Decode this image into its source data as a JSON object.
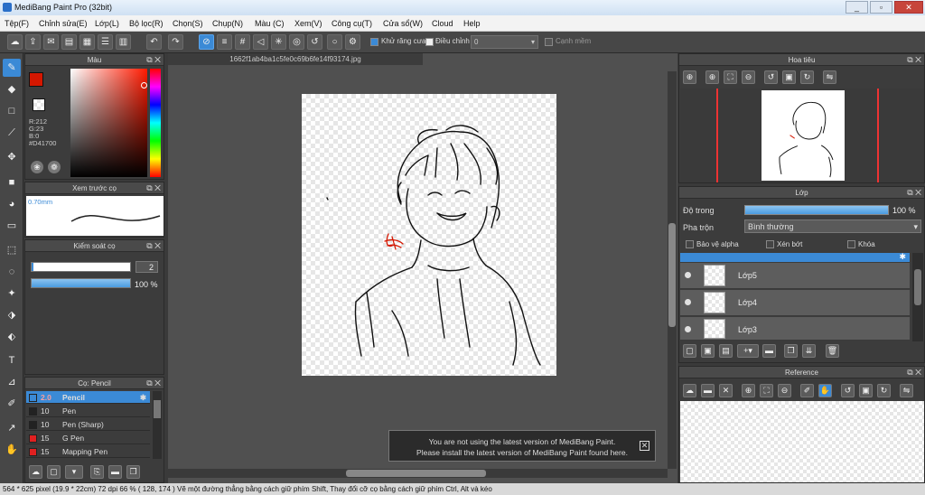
{
  "window": {
    "title": "MediBang Paint Pro (32bit)",
    "minimize": "_",
    "restore": "▫",
    "close": "✕"
  },
  "menu": [
    "Tệp(F)",
    "Chỉnh sửa(E)",
    "Lớp(L)",
    "Bộ lọc(R)",
    "Chọn(S)",
    "Chụp(N)",
    "Màu (C)",
    "Xem(V)",
    "Công cụ(T)",
    "Cửa sổ(W)",
    "Cloud",
    "Help"
  ],
  "toolbar": {
    "antialias_label": "Khử răng cưa",
    "correction_label": "Điều chỉnh",
    "correction_value": "0",
    "edge_label": "Cạnh mềm"
  },
  "color_panel": {
    "title": "Màu",
    "r": "R:212",
    "g": "G:23",
    "b": "B:0",
    "hex": "#D41700",
    "main_color": "#d41700"
  },
  "brush_preview": {
    "title": "Xem trước cọ",
    "size": "0.70mm"
  },
  "brush_control": {
    "title": "Kiểm soát cọ",
    "size_value": "2",
    "opacity_value": "100 %",
    "opacity_fraction": 1.0
  },
  "brush_list": {
    "title": "Cọ: Pencil",
    "items": [
      {
        "size": "2.0",
        "name": "Pencil",
        "color": "#3b8ad6",
        "selected": true
      },
      {
        "size": "10",
        "name": "Pen",
        "color": "#222222",
        "selected": false
      },
      {
        "size": "10",
        "name": "Pen (Sharp)",
        "color": "#222222",
        "selected": false
      },
      {
        "size": "15",
        "name": "G Pen",
        "color": "#e02020",
        "selected": false
      },
      {
        "size": "15",
        "name": "Mapping Pen",
        "color": "#e02020",
        "selected": false
      }
    ]
  },
  "document": {
    "tab_name": "1662f1ab4ba1c5fe0c69b6fe14f93174.jpg"
  },
  "notice": {
    "line1": "You are not using the latest version of MediBang Paint.",
    "line2": "Please install the latest version of MediBang Paint found here.",
    "close": "✕"
  },
  "navigator": {
    "title": "Hoa tiêu"
  },
  "layer_panel": {
    "title": "Lớp",
    "opacity_label": "Độ trong",
    "opacity_value": "100 %",
    "opacity_fraction": 1.0,
    "blend_label": "Pha trộn",
    "blend_value": "Bình thường",
    "protect_alpha": "Bảo vệ alpha",
    "clipping": "Xén bớt",
    "lock": "Khóa",
    "layers": [
      "Lớp5",
      "Lớp4",
      "Lớp3"
    ]
  },
  "reference": {
    "title": "Reference"
  },
  "status": {
    "text": "564 * 625 pixel   (19.9 * 22cm)   72 dpi   66 %   ( 128, 174 )   Vẽ một đường thẳng bằng cách giữ phím Shift, Thay đổi cỡ cọ bằng cách giữ phím Ctrl, Alt và kéo"
  }
}
